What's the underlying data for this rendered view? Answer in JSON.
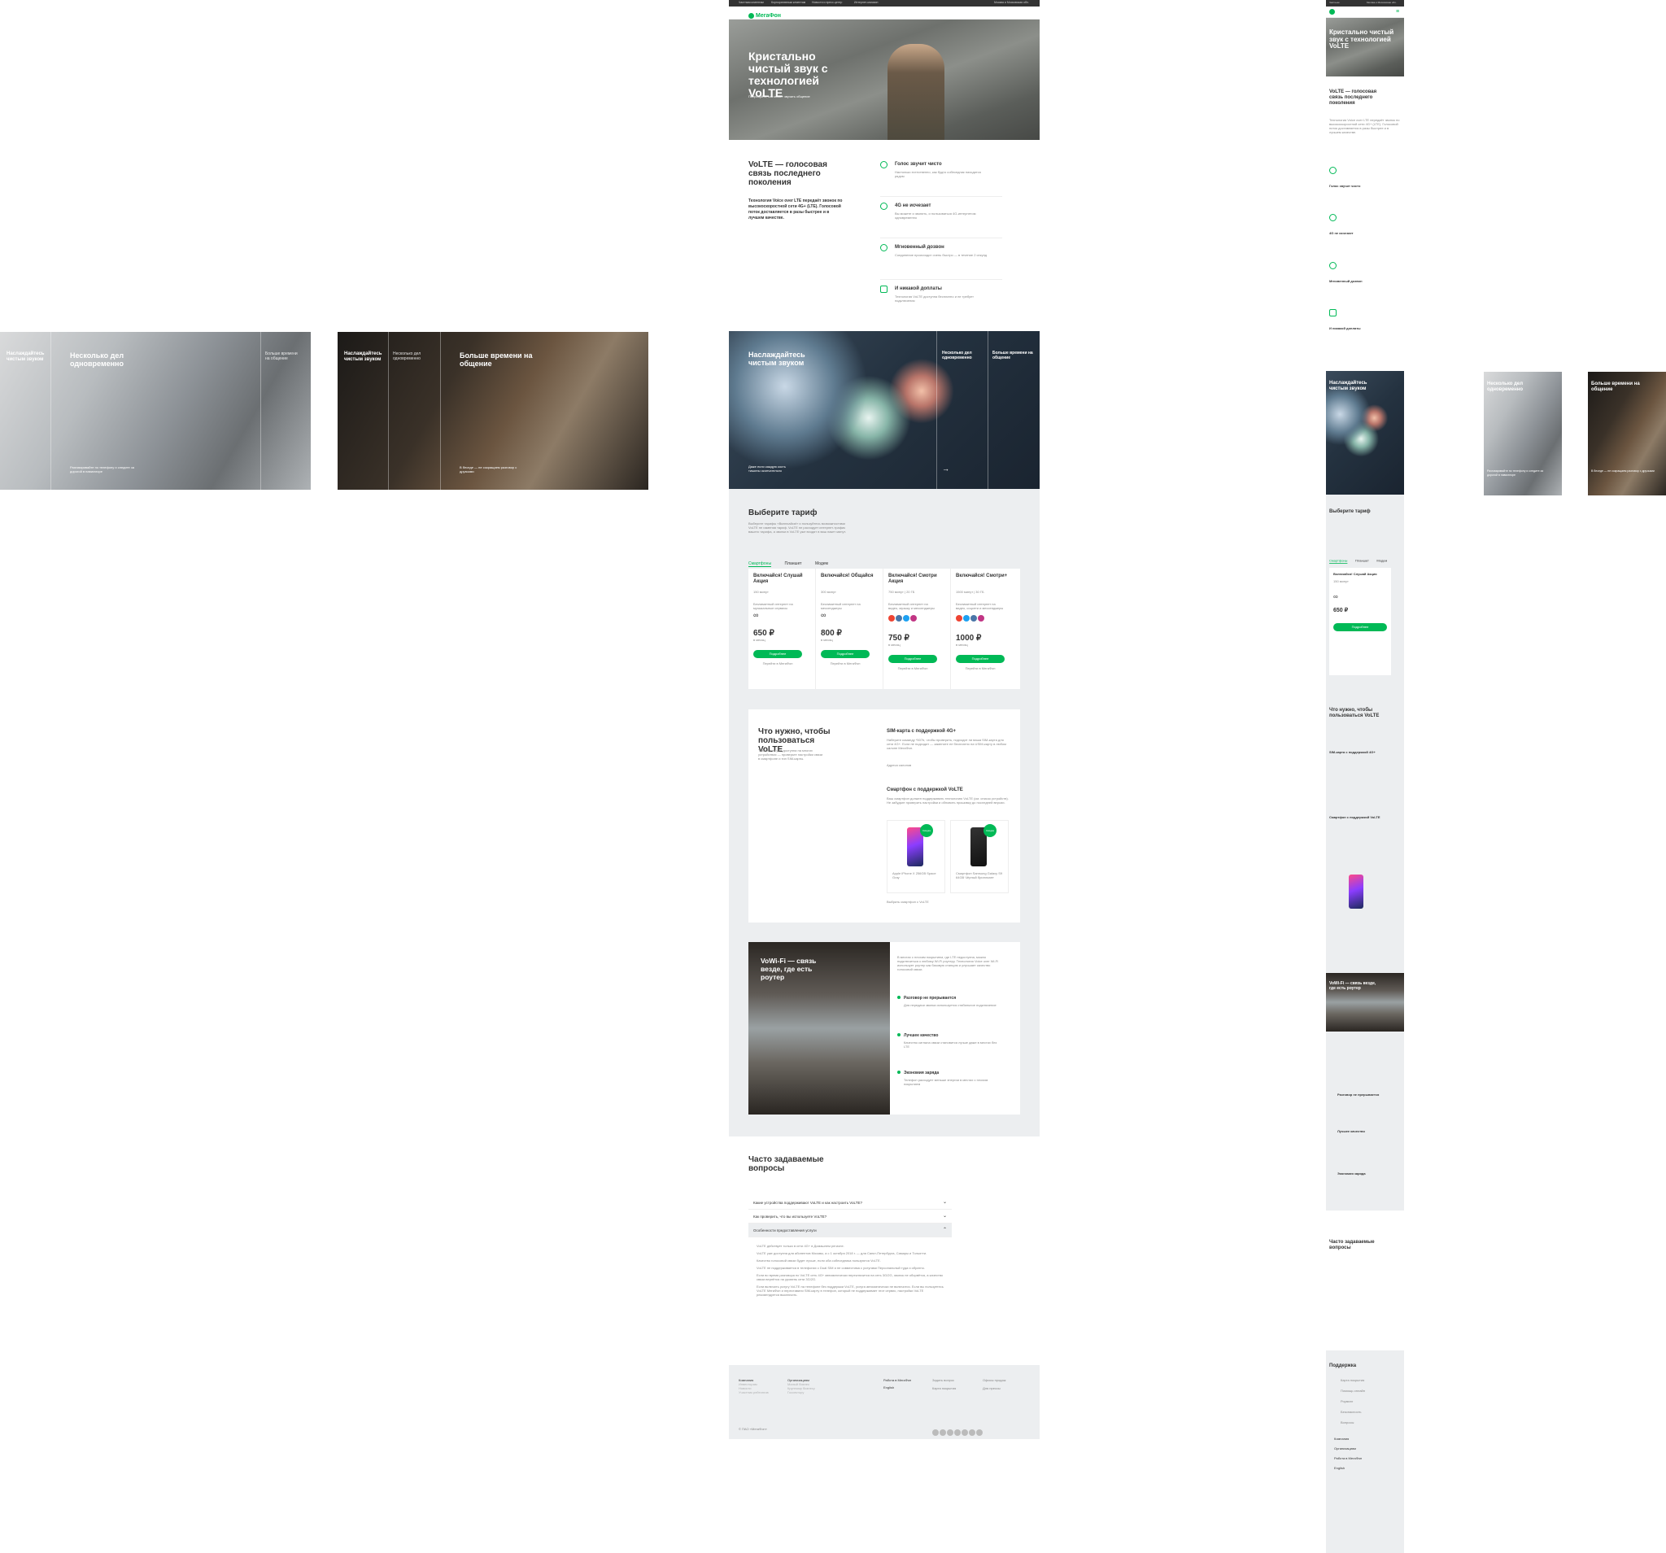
{
  "colors": {
    "brand_green": "#00b956",
    "dark_bar": "#333333",
    "grey_bg": "#eceef0"
  },
  "topbar": {
    "links": [
      "Частным клиентам",
      "Корпоративным клиентам",
      "Новости и пресс-центр",
      "Интернет-магазин"
    ],
    "region": "Москва и Московская обл.",
    "mobile_left": "Частным",
    "mobile_region": "Москва и Московская обл."
  },
  "logo": {
    "text": "МегаФон"
  },
  "hero": {
    "title": "Кристально чистый звук с технологией VoLTE",
    "subtitle": "Попробуйте, как может звучать общение"
  },
  "intro": {
    "title": "VoLTE — голосовая связь последнего поколения",
    "text": "Технология Voice over LTE передаёт звонок по высокоскоростной сети 4G+ (LTE). Голосовой поток доставляется в разы быстрее и в лучшем качестве.",
    "features": [
      {
        "icon": "voice-icon",
        "title": "Голос звучит чисто",
        "text": "Настолько естественно, как будто собеседник находится рядом"
      },
      {
        "icon": "4g-icon",
        "title": "4G не исчезает",
        "text": "Вы можете и звонить, и пользоваться 4G-интернетом одновременно"
      },
      {
        "icon": "call-icon",
        "title": "Мгновенный дозвон",
        "text": "Соединение происходит очень быстро — в течение 2 секунд"
      },
      {
        "icon": "calendar-icon",
        "title": "И никакой доплаты",
        "text": "Технология VoLTE доступна бесплатно и не требует подключения"
      }
    ]
  },
  "slider": {
    "slides": [
      {
        "title": "Наслаждайтесь чистым звуком",
        "text": "Даже если каждую кость тишины окончательно"
      },
      {
        "title": "Несколько дел одновременно",
        "text": "Разговаривайте по телефону и следите за дорогой в навигаторе"
      },
      {
        "title": "Больше времени на общение",
        "text": "В беседе — не сокращаем разговор с друзьями"
      }
    ],
    "arrow": "→"
  },
  "tariffs": {
    "title": "Выберите тариф",
    "text": "Выберите тарифы «Включайся!» и пользуйтесь возможностями VoLTE не изменяя тариф. VoLTE не расходует интернет-трафик вашего тарифа, а звонки в VoLTE уже входят в ваш пакет минут.",
    "tabs": [
      "Смартфоны",
      "Планшет",
      "Модем"
    ],
    "items": [
      {
        "name": "Включайся! Слушай Акция",
        "minutes": "150 минут",
        "note": "Безлимитный интернет на музыкальные сервисы",
        "price": "650 ₽",
        "period": "в месяц",
        "button": "Подробнее",
        "link": "Перейти в МегаФон"
      },
      {
        "name": "Включайся! Общайся",
        "minutes": "300 минут",
        "note": "Безлимитный интернет на мессенджеры",
        "price": "800 ₽",
        "period": "в месяц",
        "button": "Подробнее",
        "link": "Перейти в МегаФон"
      },
      {
        "name": "Включайся! Смотри Акция",
        "minutes": "750 минут | 20 ГБ",
        "note": "Безлимитный интернет на видео, музыку и мессенджеры",
        "price": "750 ₽",
        "period": "в месяц",
        "button": "Подробнее",
        "link": "Перейти в МегаФон"
      },
      {
        "name": "Включайся! Смотри+",
        "minutes": "1500 минут | 30 ГБ",
        "note": "Безлимитный интернет на видео, соцсети и мессенджеры",
        "price": "1000 ₽",
        "period": "в месяц",
        "button": "Подробнее",
        "link": "Перейти в МегаФон"
      }
    ]
  },
  "requirements": {
    "title": "Что нужно, чтобы пользоваться VoLTE",
    "text": "Технология уже доступна на многих устройствах — проверьте настройки связи в смартфоне и тип SIM-карты.",
    "sim_title": "SIM-карта с поддержкой 4G+",
    "sim_text": "Наберите команду *507#, чтобы проверить, подходит ли ваша SIM-карта для сети 4G+. Если не подходит — замените ее бесплатно на USIM-карту в любом салоне МегаФон.",
    "sim_link": "Адреса салонов",
    "phone_title": "Смартфон с поддержкой VoLTE",
    "phone_text": "Ваш смартфон должен поддерживать технологию VoLTE (см. список устройств). Не забудьте проверить настройки и обновить прошивку до последней версии.",
    "phones": [
      {
        "name": "Apple iPhone X 256GB Space Gray",
        "badge": "Скидка"
      },
      {
        "name": "Смартфон Samsung Galaxy S9 64GB Чёрный бриллиант",
        "badge": "Скидка"
      }
    ],
    "more_link": "Выбрать смартфон с VoLTE"
  },
  "vowifi": {
    "title": "VoWi-Fi — связь везде, где есть роутер",
    "text": "В местах с плохим покрытием, где LTE недоступна, можно подключиться к любому Wi-Fi роутеру. Технология Voice over Wi-Fi использует роутер как базовую станцию и улучшает качество голосовой связи.",
    "points": [
      {
        "title": "Разговор не прерывается",
        "text": "Для передачи звонка используется стабильное подключение"
      },
      {
        "title": "Лучшее качество",
        "text": "Качество сигнала связи становится лучше даже в местах без LTE"
      },
      {
        "title": "Экономия заряда",
        "text": "Телефон расходует меньше энергии в местах с плохим покрытием"
      }
    ]
  },
  "faq": {
    "title": "Часто задаваемые вопросы",
    "items": [
      {
        "q": "Какие устройства поддерживают VoLTE и как настроить VoLTE?",
        "open": false
      },
      {
        "q": "Как проверить, что вы используете VoLTE?",
        "open": false
      },
      {
        "q": "Особенности предоставления услуги",
        "open": true
      }
    ],
    "answers": [
      "VoLTE действует только в сети 4G+ в Домашнем регионе.",
      "VoLTE уже доступна для абонентов Москвы, а с 1 октября 2018 г. — для Санкт-Петербурга, Самары и Тольятти.",
      "Качество голосовой связи будет лучше, если оба собеседника пользуются VoLTE.",
      "VoLTE не поддерживается в телефонах с Dual SIM и не совместима с услугами Персональный туда и обратно.",
      "Если во время разговора по VoLTE сеть 4G+ автоматически переключится на сеть 3G/2G, звонок не оборвётся, а качество связи вернётся на уровень сети 3G/2G.",
      "Если включить услугу VoLTE на телефоне без поддержки VoLTE, услуга автоматически не включится. Если вы пользуетесь VoLTE МегаФон и переставили SIM-карту в телефон, который не поддерживает этот сервис, настройки VoLTE рекомендуется выключить."
    ]
  },
  "footer": {
    "columns": [
      {
        "title": "Компания",
        "links": [
          "Инвесторам",
          "Новости",
          "Участник рейтингов"
        ]
      },
      {
        "title": "Организациям",
        "links": [
          "Малый бизнес",
          "Крупному бизнесу",
          "Госсектору"
        ]
      },
      {
        "title": "Работа в МегаФон",
        "links": [
          "English"
        ]
      }
    ],
    "contacts": [
      "Задать вопрос",
      "Карта покрытия",
      "Офисы продаж",
      "Для прессы"
    ],
    "copyright": "© ПАО «МегаФон»",
    "social": [
      "vk-icon",
      "ok-icon",
      "fb-icon",
      "tw-icon",
      "yt-icon",
      "tg-icon",
      "ig-icon"
    ]
  },
  "mobile": {
    "support_title": "Поддержка",
    "support_items": [
      "Карта покрытия",
      "Помощь онлайн",
      "Роуминг",
      "Безопасность",
      "Вопросы"
    ],
    "footer_links": [
      "Компания",
      "Организациям",
      "Работа в МегаФон",
      "English"
    ]
  }
}
